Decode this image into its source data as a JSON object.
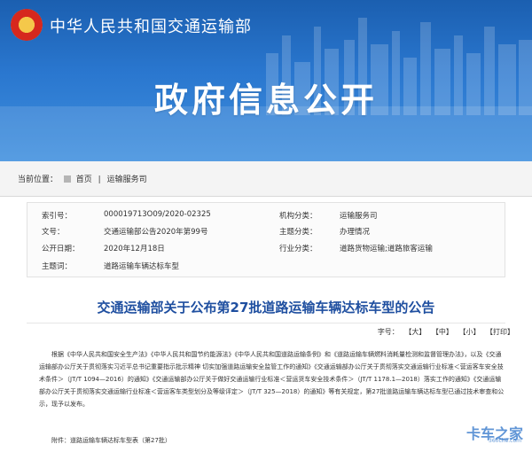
{
  "header": {
    "ministry_name": "中华人民共和国交通运输部",
    "hero_title": "政府信息公开",
    "brand_color": "#2a77cf"
  },
  "breadcrumb": {
    "label": "当前位置：",
    "home": "首页",
    "separator": "|",
    "current": "运输服务司"
  },
  "meta": {
    "index_label": "索引号：",
    "index_value": "000019713O09/2020-02325",
    "org_label": "机构分类：",
    "org_value": "运输服务司",
    "doc_label": "文号：",
    "doc_value": "交通运输部公告2020年第99号",
    "topic_label": "主题分类：",
    "topic_value": "办理情况",
    "date_label": "公开日期：",
    "date_value": "2020年12月18日",
    "industry_label": "行业分类：",
    "industry_value": "道路货物运输;道路旅客运输",
    "subject_label": "主题词：",
    "subject_value": "道路运输车辆达标车型"
  },
  "article": {
    "title": "交通运输部关于公布第27批道路运输车辆达标车型的公告",
    "font_label": "字号：",
    "font_large": "【大】",
    "font_medium": "【中】",
    "font_small": "【小】",
    "print": "【打印】",
    "body": "根据《中华人民共和国安全生产法》《中华人民共和国节约能源法》《中华人民共和国道路运输条例》和《道路运输车辆燃料消耗量检测和监督管理办法》，以及《交通运输部办公厅关于贯彻落实习近平总书记重要指示批示精神 切实加强道路运输安全监管工作的通知》《交通运输部办公厅关于贯彻落实交通运输行业标准＜营运客车安全技术条件＞（JT/T 1094—2016）的通知》《交通运输部办公厅关于做好交通运输行业标准＜营运货车安全技术条件＞（JT/T 1178.1—2018）落实工作的通知》《交通运输部办公厅关于贯彻落实交通运输行业标准＜营运客车类型划分及等级评定＞（JT/T 325—2018）的通知》等有关规定，第27批道路运输车辆达标车型已通过技术审查和公示，现予以发布。",
    "attachment": "附件：道路运输车辆达标车型表（第27批）"
  },
  "watermark": {
    "brand": "卡车之家",
    "site": "360che.com"
  }
}
